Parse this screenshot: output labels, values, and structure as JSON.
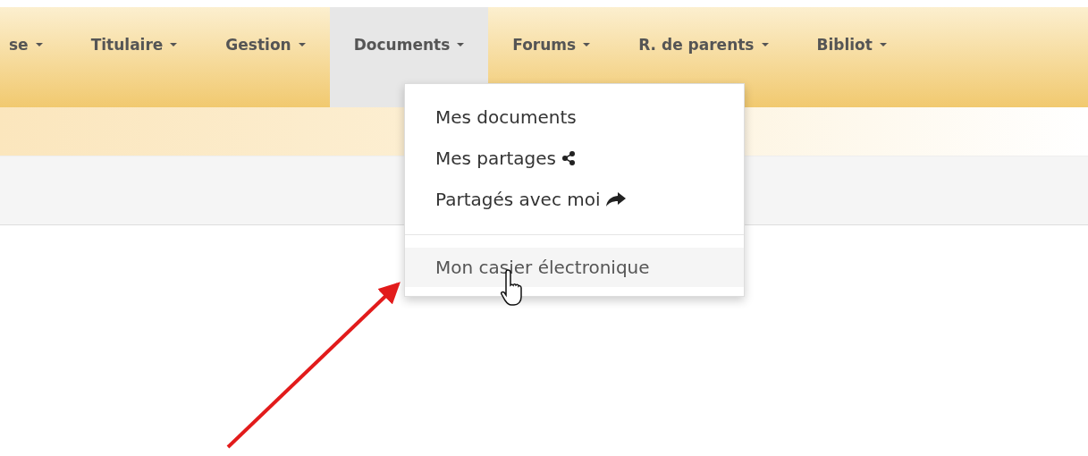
{
  "navbar": {
    "items": [
      {
        "label": "se",
        "selected": false
      },
      {
        "label": "Titulaire",
        "selected": false
      },
      {
        "label": "Gestion",
        "selected": false
      },
      {
        "label": "Documents",
        "selected": true
      },
      {
        "label": "Forums",
        "selected": false
      },
      {
        "label": "R. de parents",
        "selected": false
      },
      {
        "label": "Bibliot",
        "selected": false
      }
    ]
  },
  "dropdown": {
    "items": [
      {
        "kind": "link",
        "label": "Mes documents",
        "highlighted": false
      },
      {
        "kind": "share-link",
        "label": "Mes partages",
        "highlighted": false
      },
      {
        "kind": "received-link",
        "label": "Partagés avec moi",
        "highlighted": false
      },
      {
        "kind": "divider"
      },
      {
        "kind": "link",
        "label": "Mon casier électronique",
        "highlighted": true
      }
    ]
  }
}
